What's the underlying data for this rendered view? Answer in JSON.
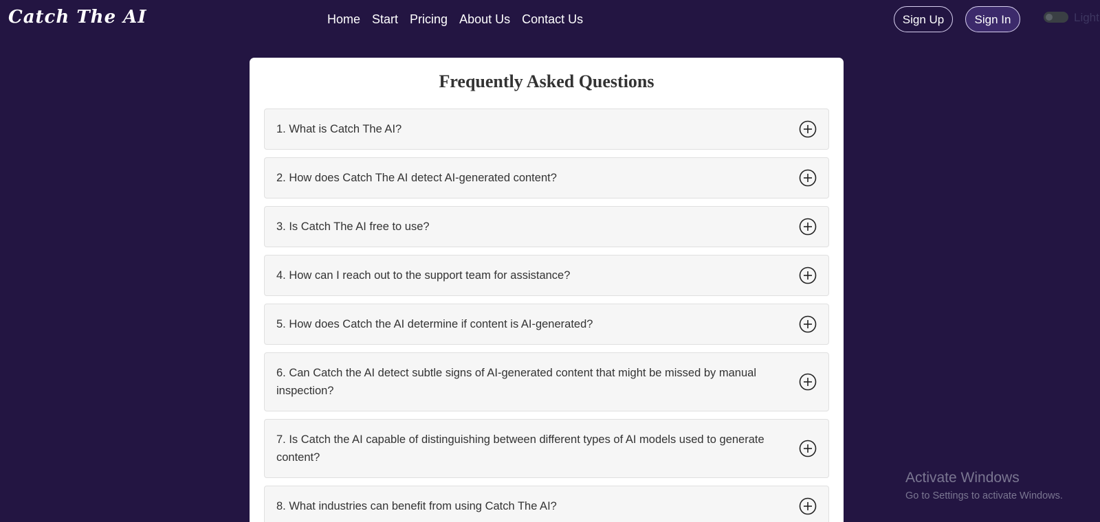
{
  "header": {
    "brand": "Catch The AI",
    "nav": [
      "Home",
      "Start",
      "Pricing",
      "About Us",
      "Contact Us"
    ],
    "sign_up": "Sign Up",
    "sign_in": "Sign In",
    "theme_toggle_label": "Light",
    "theme_toggle_on": false
  },
  "faq": {
    "title": "Frequently Asked Questions",
    "items": [
      "1. What is Catch The AI?",
      "2. How does Catch The AI detect AI-generated content?",
      "3. Is Catch The AI free to use?",
      "4. How can I reach out to the support team for assistance?",
      "5. How does Catch the AI determine if content is AI-generated?",
      "6. Can Catch the AI detect subtle signs of AI-generated content that might be missed by manual inspection?",
      "7. Is Catch the AI capable of distinguishing between different types of AI models used to generate content?",
      "8. What industries can benefit from using Catch The AI?"
    ],
    "expand_icon": "plus-circle-icon"
  },
  "watermark": {
    "title": "Activate Windows",
    "subtitle": "Go to Settings to activate Windows."
  },
  "colors": {
    "background": "#231542",
    "card": "#ffffff",
    "item_bg": "#f6f6f6",
    "sign_in_bg": "#3c2a6b"
  }
}
